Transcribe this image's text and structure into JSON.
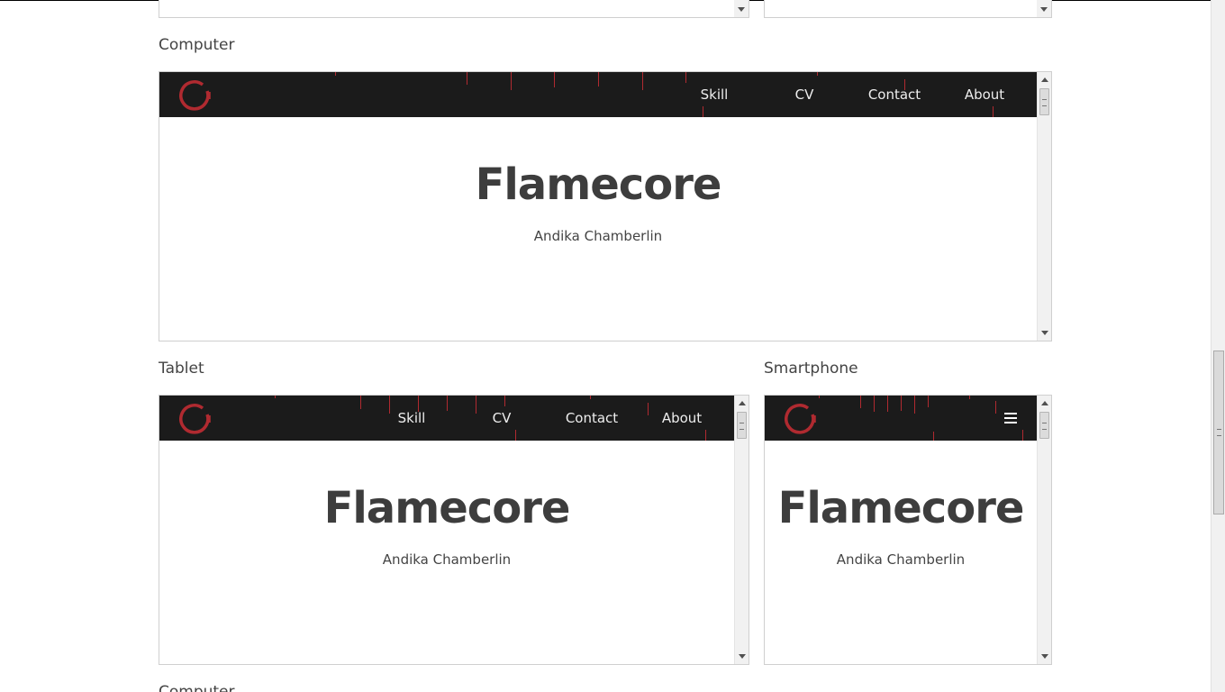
{
  "sections": {
    "computer_label": "Computer",
    "tablet_label": "Tablet",
    "smartphone_label": "Smartphone",
    "next_computer_label": "Computer"
  },
  "site": {
    "title": "Flamecore",
    "subtitle": "Andika Chamberlin",
    "nav": [
      "Skill",
      "CV",
      "Contact",
      "About"
    ],
    "logo_icon": "power-ring-icon",
    "menu_icon": "hamburger-menu-icon"
  },
  "colors": {
    "navbar_bg": "#1b1b1b",
    "accent_red": "#b02a30",
    "title_text": "#3d3d3d"
  }
}
